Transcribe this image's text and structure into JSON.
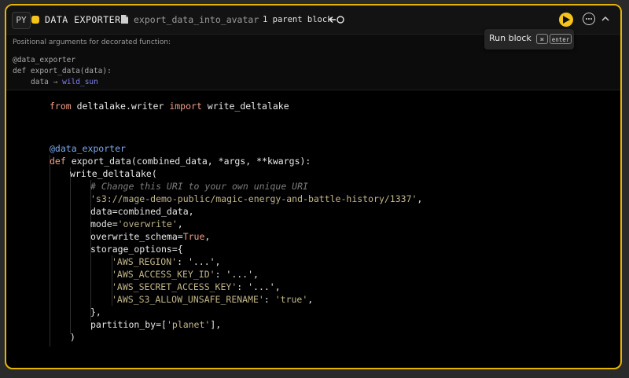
{
  "header": {
    "language_badge": "PY",
    "block_type": "DATA EXPORTER",
    "file_icon": "file-icon",
    "file_name": "export_data_into_avatar",
    "parent_block_label": "1 parent block",
    "link_icon": "connection-icon",
    "run_icon": "play-icon",
    "more_icon": "ellipsis-icon",
    "collapse_icon": "chevron-up-icon",
    "accent_color": "#f6c21c"
  },
  "tooltip": {
    "label": "Run block",
    "key_cmd": "⌘",
    "key_enter": "enter"
  },
  "args_panel": {
    "description": "Positional arguments for decorated function:",
    "decorator_line": "@data_exporter",
    "def_line": "def export_data(data):",
    "arg_name": "data",
    "arrow": "→",
    "arg_source": "wild_sun"
  },
  "code": {
    "import_from": "from",
    "import_module": " deltalake.writer ",
    "import_kw": "import",
    "import_name": " write_deltalake",
    "decorator": "@data_exporter",
    "def_kw": "def",
    "def_sig": " export_data(combined_data, *args, **kwargs):",
    "call_open": "write_deltalake(",
    "comment": "# Change this URI to your own unique URI",
    "uri": "'s3://mage-demo-public/magic-energy-and-battle-history/1337'",
    "uri_comma": ",",
    "data_arg": "data=combined_data,",
    "mode_key": "mode=",
    "mode_val": "'overwrite'",
    "mode_comma": ",",
    "schema_key": "overwrite_schema=",
    "schema_val": "True",
    "schema_comma": ",",
    "storage_open": "storage_options={",
    "region_key": "'AWS_REGION'",
    "region_rest": ": '...',",
    "access_key": "'AWS_ACCESS_KEY_ID'",
    "access_rest": ": '...',",
    "secret_key": "'AWS_SECRET_ACCESS_KEY'",
    "secret_rest": ": '...',",
    "rename_key": "'AWS_S3_ALLOW_UNSAFE_RENAME'",
    "rename_mid": ": ",
    "rename_val": "'true'",
    "rename_comma": ",",
    "storage_close": "},",
    "partition_key": "partition_by=[",
    "partition_val": "'planet'",
    "partition_close": "],",
    "call_close": ")"
  }
}
